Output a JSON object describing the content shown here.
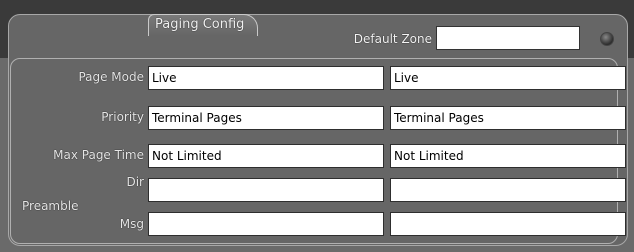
{
  "header": {
    "tab_label": "Paging Config",
    "default_zone_label": "Default Zone",
    "default_zone_value": ""
  },
  "rows": {
    "page_mode": {
      "label": "Page Mode",
      "col1": "Live",
      "col2": "Live"
    },
    "priority": {
      "label": "Priority",
      "col1": "Terminal Pages",
      "col2": "Terminal Pages"
    },
    "max_page_time": {
      "label": "Max Page Time",
      "col1": "Not Limited",
      "col2": "Not Limited"
    },
    "preamble": {
      "label": "Preamble",
      "dir": {
        "label": "Dir",
        "col1": "",
        "col2": ""
      },
      "msg": {
        "label": "Msg",
        "col1": "",
        "col2": ""
      }
    }
  }
}
